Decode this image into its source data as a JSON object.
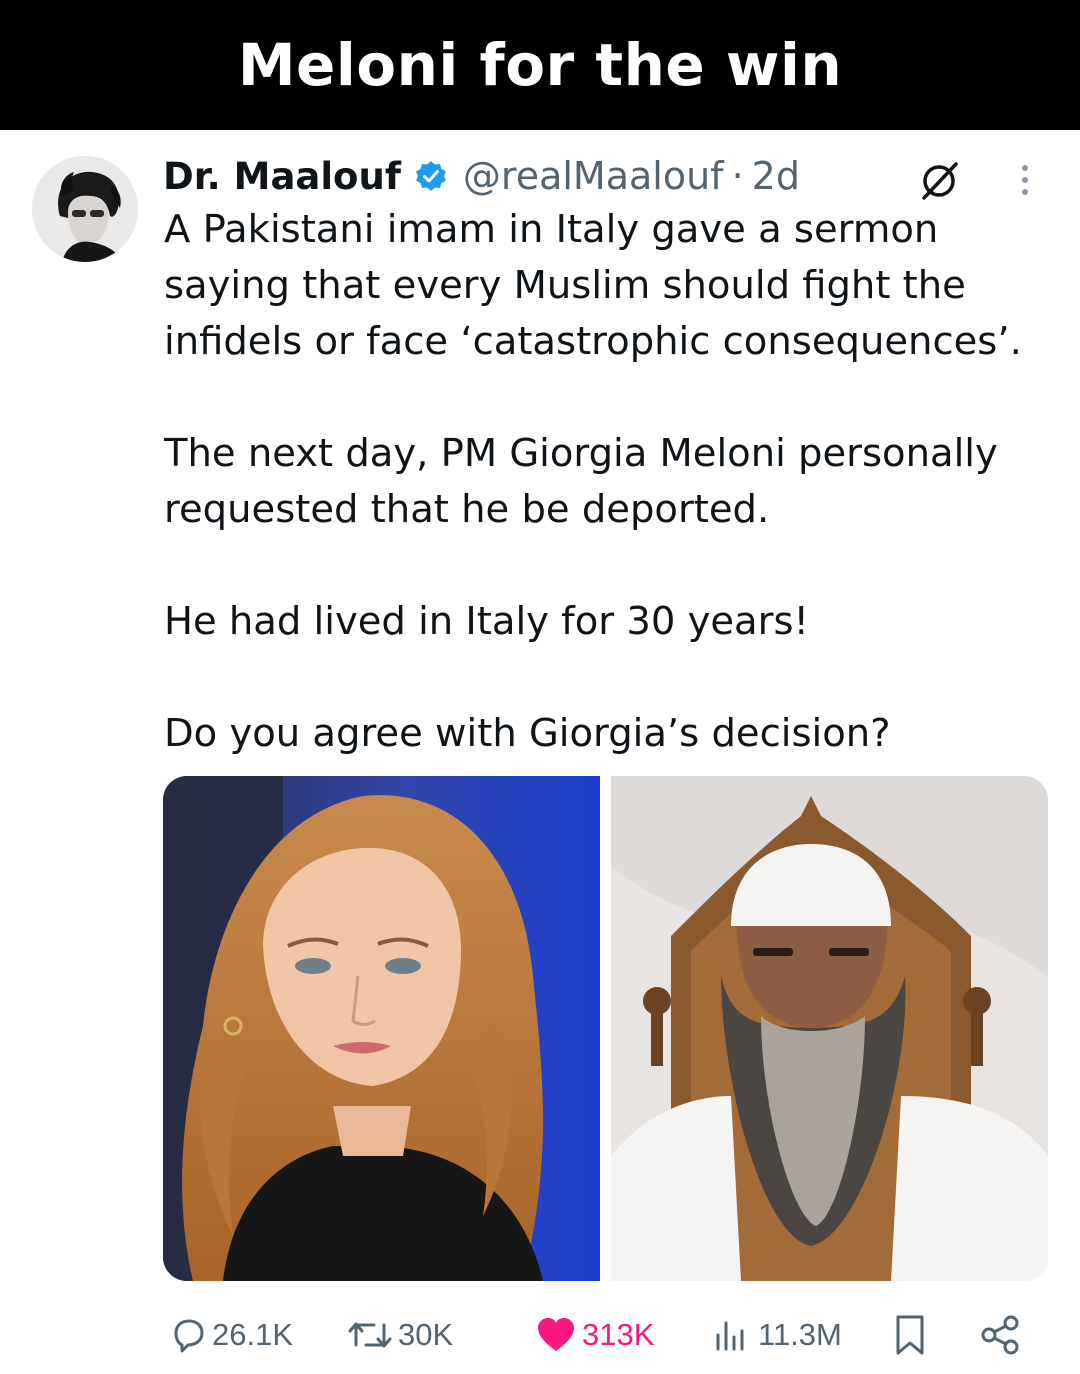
{
  "banner": {
    "title": "Meloni for the win"
  },
  "tweet": {
    "author": {
      "display_name": "Dr. Maalouf",
      "handle": "@realMaalouf",
      "separator": "·",
      "age": "2d",
      "verified": true
    },
    "paragraphs": [
      [
        "A Pakistani imam in Italy gave a sermon",
        "saying that every Muslim should fight the",
        "infidels or face ‘catastrophic consequences’."
      ],
      [
        "The next day, PM Giorgia Meloni personally",
        "requested that he be deported."
      ],
      [
        "He had lived in Italy for 30 years!"
      ],
      [
        "Do you agree with Giorgia’s decision?"
      ]
    ],
    "media": [
      {
        "icon": "photo-woman-portrait"
      },
      {
        "icon": "photo-bearded-man-portrait"
      }
    ],
    "actions": {
      "replies": "26.1K",
      "reposts": "30K",
      "likes": "313K",
      "views": "11.3M"
    }
  },
  "colors": {
    "banner_bg": "#000000",
    "verified_blue": "#1d9bf0",
    "secondary_text": "#536471",
    "like_pink": "#f91880"
  }
}
